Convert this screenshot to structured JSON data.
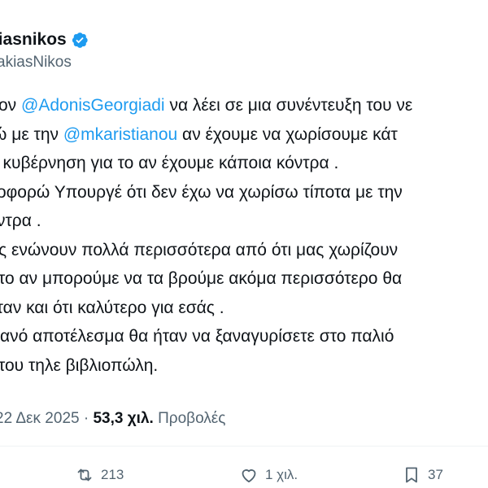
{
  "author": {
    "display_name": "kiasnikos",
    "handle": "akiasNikos",
    "verified": true
  },
  "tweet_lines": [
    [
      {
        "t": "ον "
      },
      {
        "t": "@AdonisGeorgiadi",
        "m": true
      },
      {
        "t": " να λέει σε μια συνέντευξη του νε"
      }
    ],
    [
      {
        "t": "ώ με την "
      },
      {
        "t": "@mkaristianou",
        "m": true
      },
      {
        "t": " αν έχουμε να χωρίσουμε κάτ"
      }
    ],
    [
      {
        "t": " η κυβέρνηση για το αν έχουμε κάποια κόντρα ."
      }
    ],
    [
      {
        "t": "οφορώ Υπουργέ ότι δεν έχω να χωρίσω τίποτα με την"
      }
    ],
    [
      {
        "t": "ντρα ."
      }
    ],
    [
      {
        "t": "ς ενώνουν πολλά περισσότερα από ότι μας χωρίζουν"
      }
    ],
    [
      {
        "t": "το αν μπορούμε να τα βρούμε ακόμα περισσότερο θα"
      }
    ],
    [
      {
        "t": " ήταν και ότι καλύτερο για εσάς ."
      }
    ],
    [
      {
        "t": "ανό αποτέλεσμα θα ήταν να ξαναγυρίσετε στο παλιό"
      }
    ],
    [
      {
        "t": "του τηλε βιβλιοπώλη."
      }
    ]
  ],
  "meta": {
    "date": "22 Δεκ 2025",
    "separator": " · ",
    "views_count": "53,3 χιλ.",
    "views_label": " Προβολές"
  },
  "actions": {
    "reposts": "213",
    "likes": "1 χιλ.",
    "bookmarks": "37"
  },
  "colors": {
    "text": "#0f1419",
    "secondary": "#536471",
    "mention": "#1d9bf0",
    "verified": "#1d9bf0"
  },
  "icons": {
    "verified": "verified-badge-icon",
    "repost": "repost-icon",
    "like": "heart-icon",
    "bookmark": "bookmark-icon"
  }
}
